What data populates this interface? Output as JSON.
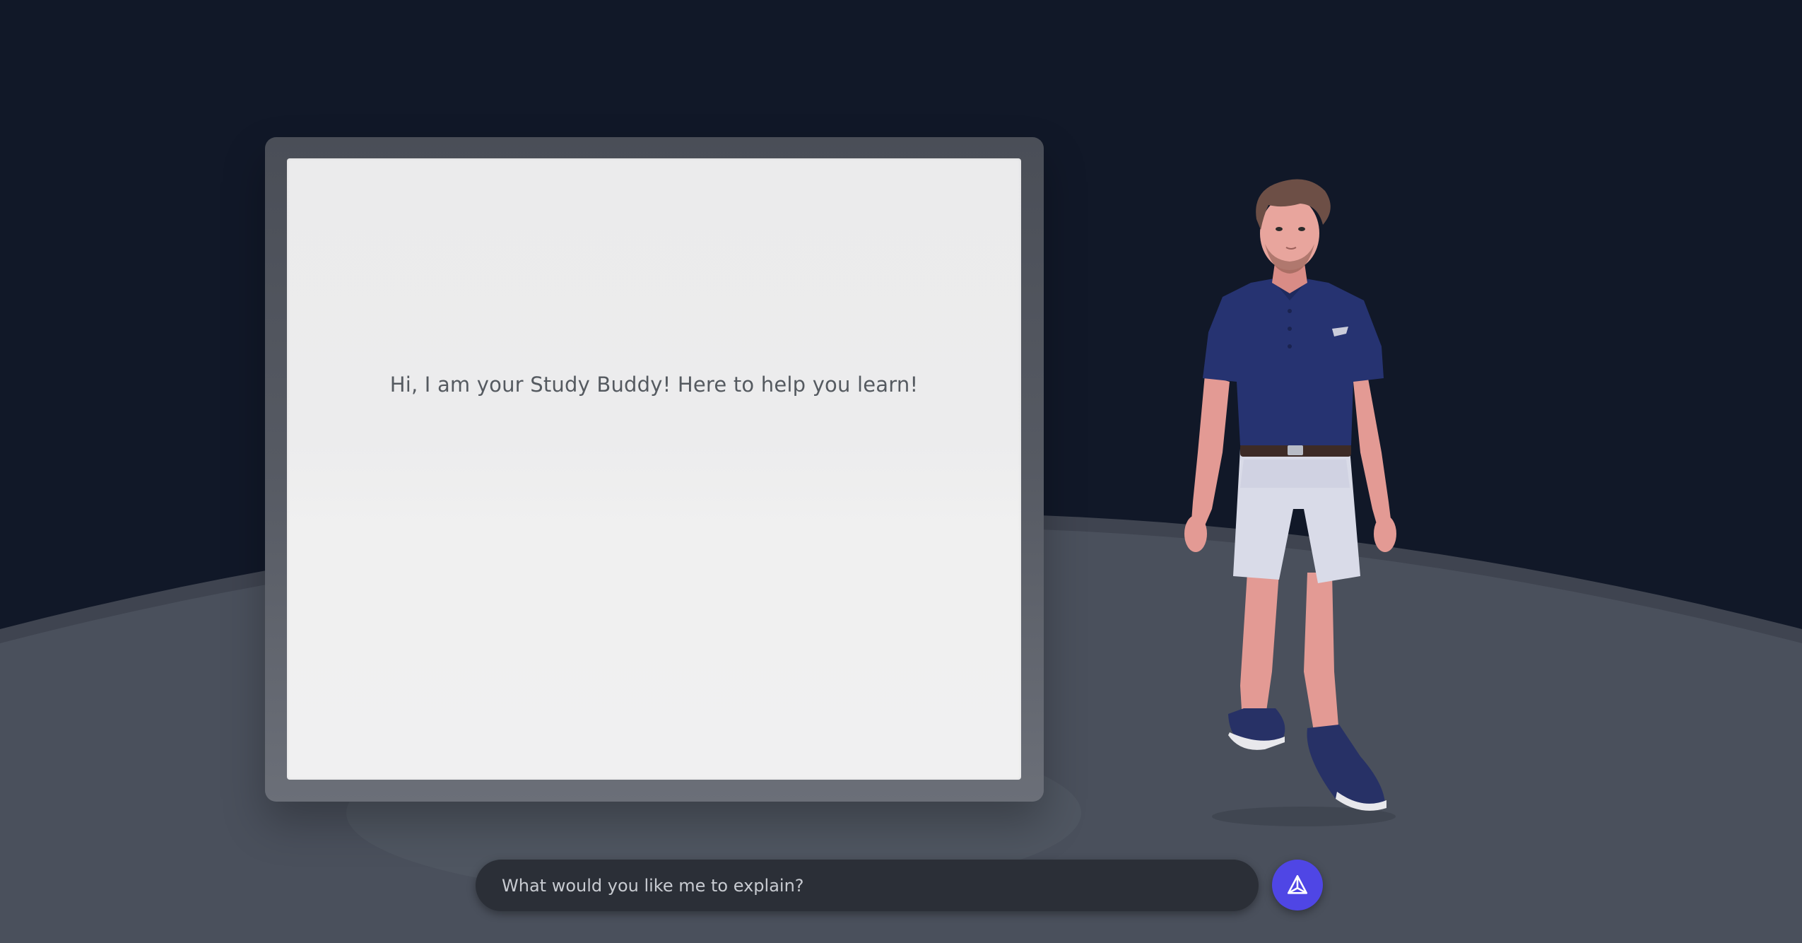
{
  "board": {
    "message": "Hi, I am your Study Buddy! Here to help you learn!"
  },
  "chat": {
    "placeholder": "What would you like me to explain?",
    "value": ""
  },
  "send_button": {
    "icon": "send-icon"
  },
  "colors": {
    "background": "#111828",
    "floor": "#4a505c",
    "chat_bar": "#2b2f37",
    "accent": "#4f46e5"
  }
}
